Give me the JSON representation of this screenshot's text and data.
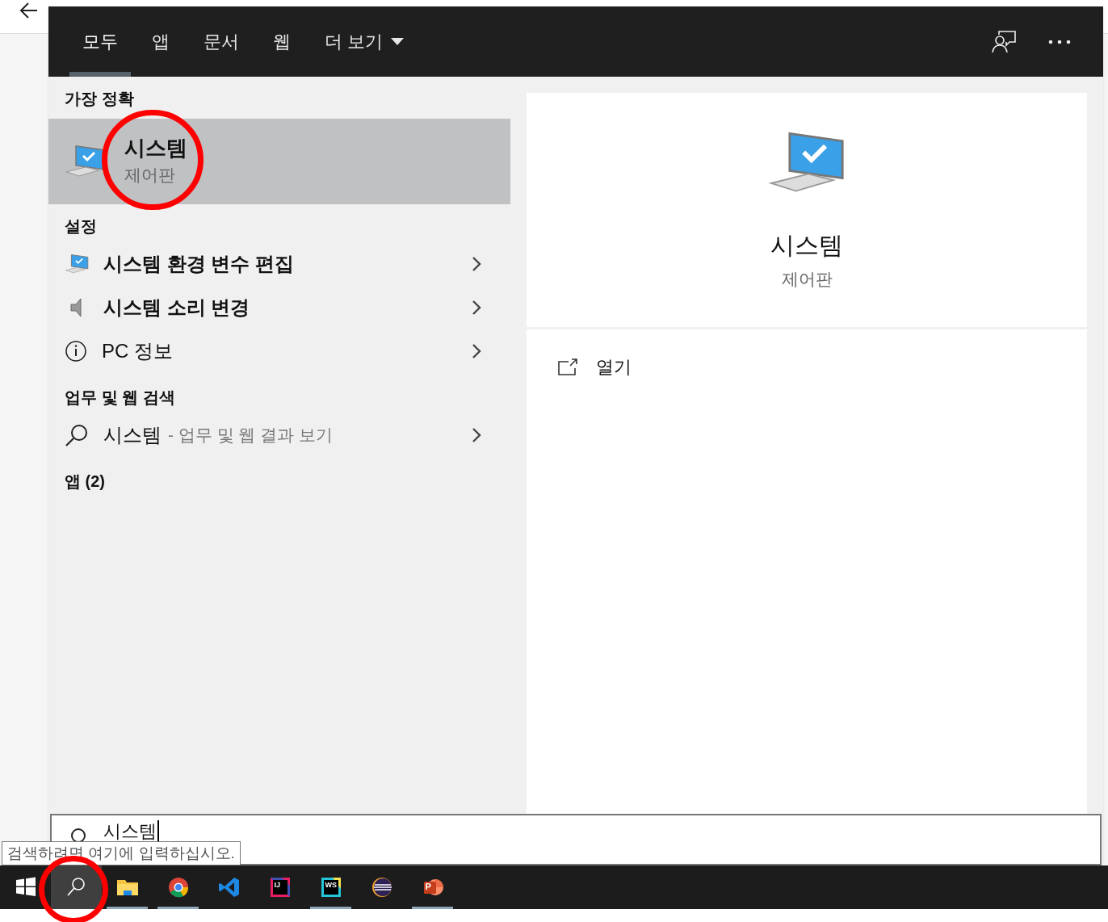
{
  "tabs": [
    {
      "label": "모두",
      "selected": true
    },
    {
      "label": "앱",
      "selected": false
    },
    {
      "label": "문서",
      "selected": false
    },
    {
      "label": "웹",
      "selected": false
    },
    {
      "label": "더 보기",
      "selected": false,
      "kind": "dropdown"
    }
  ],
  "best_match": {
    "heading": "가장 정확",
    "title": "시스템",
    "subtitle": "제어판",
    "selected": true
  },
  "sections": [
    {
      "heading": "설정",
      "items": [
        {
          "kind": "computer",
          "label": "시스템 환경 변수 편집"
        },
        {
          "kind": "speaker",
          "label": "시스템 소리 변경"
        },
        {
          "kind": "info",
          "label": "PC 정보"
        }
      ]
    },
    {
      "heading": "업무 및 웹 검색",
      "items": [
        {
          "kind": "search",
          "label": "시스템",
          "hint": "- 업무 및 웹 결과 보기"
        }
      ]
    },
    {
      "heading": "앱 (2)"
    }
  ],
  "preview": {
    "title": "시스템",
    "subtitle": "제어판",
    "actions": [
      {
        "label": "열기"
      }
    ]
  },
  "search": {
    "value": "시스템"
  },
  "tooltip": "검색하려면 여기에 입력하십시오.",
  "taskbar": [
    {
      "kind": "start",
      "running": false,
      "selected": false
    },
    {
      "kind": "search",
      "running": false,
      "selected": true
    },
    {
      "kind": "explorer",
      "running": true,
      "selected": false
    },
    {
      "kind": "chrome",
      "running": true,
      "selected": false
    },
    {
      "kind": "vscode",
      "running": false,
      "selected": false
    },
    {
      "kind": "intellij",
      "badge": "IJ",
      "running": false,
      "selected": false
    },
    {
      "kind": "webstorm",
      "badge": "WS",
      "running": true,
      "selected": false
    },
    {
      "kind": "eclipse",
      "running": false,
      "selected": false
    },
    {
      "kind": "powerpoint",
      "badge": "P",
      "running": true,
      "selected": false
    }
  ]
}
